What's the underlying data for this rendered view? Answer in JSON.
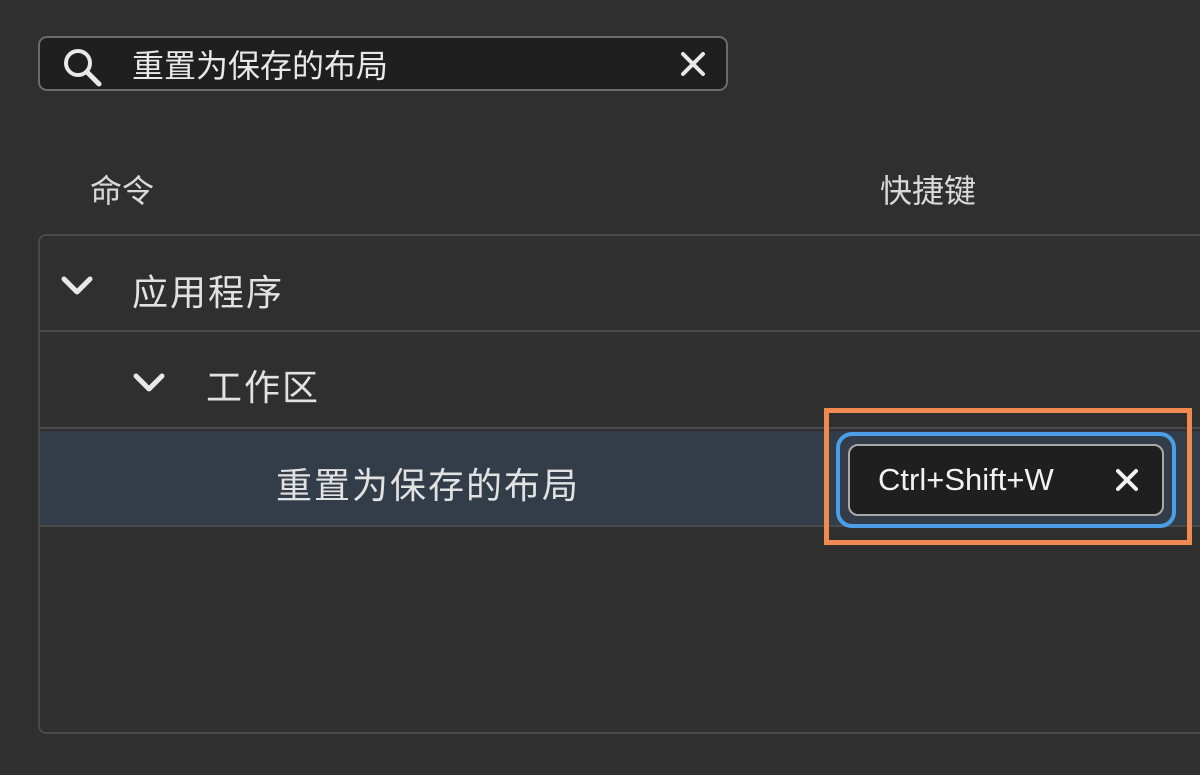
{
  "search": {
    "value": "重置为保存的布局",
    "icon": "search-icon",
    "clear_icon": "close-icon"
  },
  "columns": {
    "command": "命令",
    "shortcut": "快捷键"
  },
  "tree": {
    "group": {
      "label": "应用程序",
      "expanded": true,
      "subgroup": {
        "label": "工作区",
        "expanded": true,
        "command": {
          "label": "重置为保存的布局",
          "shortcut": "Ctrl+Shift+W"
        }
      }
    }
  },
  "colors": {
    "background": "#2f2f2f",
    "selected_row": "#333d49",
    "focus_ring": "#4a9fe8",
    "highlight_frame": "#f08a50"
  }
}
